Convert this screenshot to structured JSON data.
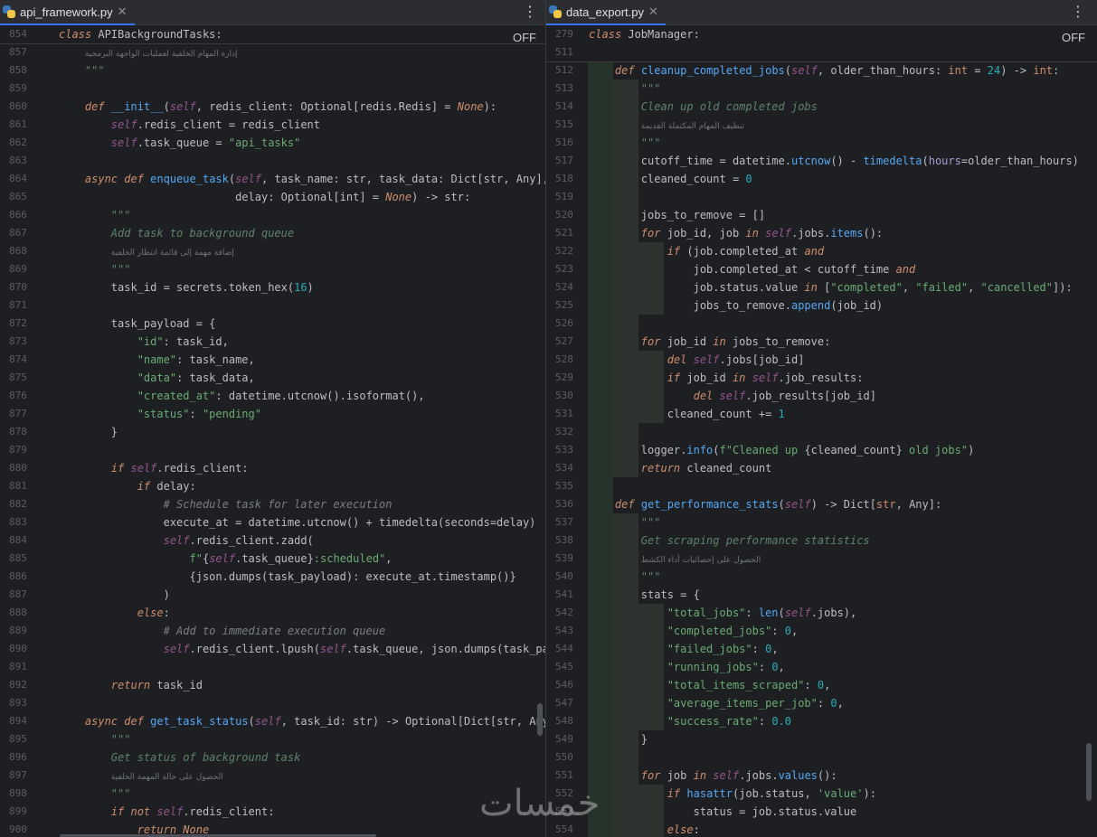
{
  "left": {
    "tab_label": "api_framework.py",
    "sticky_line_number": "854",
    "sticky_kw": "class",
    "sticky_name": " APIBackgroundTasks:",
    "off_label": "OFF",
    "lines": [
      {
        "n": "857",
        "html": "    <span class='ar'>إدارة المهام الخلفية لعمليات الواجهة البرمجية</span>"
      },
      {
        "n": "858",
        "html": "    <span class='doc'>\"\"\"</span>"
      },
      {
        "n": "859",
        "html": ""
      },
      {
        "n": "860",
        "html": "    <span class='kwi'>def</span> <span class='fn'>__init__</span>(<span class='self'>self</span>, redis_client: Optional[redis.Redis] = <span class='kwi'>None</span>):"
      },
      {
        "n": "861",
        "html": "        <span class='self'>self</span>.redis_client = redis_client"
      },
      {
        "n": "862",
        "html": "        <span class='self'>self</span>.task_queue = <span class='str'>\"api_tasks\"</span>"
      },
      {
        "n": "863",
        "html": ""
      },
      {
        "n": "864",
        "html": "    <span class='kwi'>async def</span> <span class='fn'>enqueue_task</span>(<span class='self'>self</span>, task_name: str, task_data: Dict[str, Any],"
      },
      {
        "n": "865",
        "html": "                           delay: Optional[int] = <span class='kwi'>None</span>) -> str:"
      },
      {
        "n": "866",
        "html": "        <span class='doc'>\"\"\"</span>"
      },
      {
        "n": "867",
        "html": "        <span class='doc'>Add task to background queue</span>"
      },
      {
        "n": "868",
        "html": "        <span class='ar'>إضافة مهمة إلى قائمة انتظار الخلفية</span>"
      },
      {
        "n": "869",
        "html": "        <span class='doc'>\"\"\"</span>"
      },
      {
        "n": "870",
        "html": "        task_id = secrets.token_hex(<span class='num'>16</span>)"
      },
      {
        "n": "871",
        "html": ""
      },
      {
        "n": "872",
        "html": "        task_payload = {"
      },
      {
        "n": "873",
        "html": "            <span class='str'>\"id\"</span>: task_id,"
      },
      {
        "n": "874",
        "html": "            <span class='str'>\"name\"</span>: task_name,"
      },
      {
        "n": "875",
        "html": "            <span class='str'>\"data\"</span>: task_data,"
      },
      {
        "n": "876",
        "html": "            <span class='str'>\"created_at\"</span>: datetime.utcnow().isoformat(),"
      },
      {
        "n": "877",
        "html": "            <span class='str'>\"status\"</span>: <span class='str'>\"pending\"</span>"
      },
      {
        "n": "878",
        "html": "        }"
      },
      {
        "n": "879",
        "html": ""
      },
      {
        "n": "880",
        "html": "        <span class='kwi'>if</span> <span class='self'>self</span>.redis_client:"
      },
      {
        "n": "881",
        "html": "            <span class='kwi'>if</span> delay:"
      },
      {
        "n": "882",
        "html": "                <span class='cmt'># Schedule task for later execution</span>"
      },
      {
        "n": "883",
        "html": "                execute_at = datetime.utcnow() + timedelta(seconds=delay)"
      },
      {
        "n": "884",
        "html": "                <span class='self'>self</span>.redis_client.zadd("
      },
      {
        "n": "885",
        "html": "                    <span class='str'>f\"</span>{<span class='self'>self</span>.task_queue}<span class='str'>:scheduled\"</span>,"
      },
      {
        "n": "886",
        "html": "                    {json.dumps(task_payload): execute_at.timestamp()}"
      },
      {
        "n": "887",
        "html": "                )"
      },
      {
        "n": "888",
        "html": "            <span class='kwi'>else</span>:"
      },
      {
        "n": "889",
        "html": "                <span class='cmt'># Add to immediate execution queue</span>"
      },
      {
        "n": "890",
        "html": "                <span class='self'>self</span>.redis_client.lpush(<span class='self'>self</span>.task_queue, json.dumps(task_payl"
      },
      {
        "n": "891",
        "html": ""
      },
      {
        "n": "892",
        "html": "        <span class='kwi'>return</span> task_id"
      },
      {
        "n": "893",
        "html": ""
      },
      {
        "n": "894",
        "html": "    <span class='kwi'>async def</span> <span class='fn'>get_task_status</span>(<span class='self'>self</span>, task_id: str) -> Optional[Dict[str, Any]]"
      },
      {
        "n": "895",
        "html": "        <span class='doc'>\"\"\"</span>"
      },
      {
        "n": "896",
        "html": "        <span class='doc'>Get status of background task</span>"
      },
      {
        "n": "897",
        "html": "        <span class='ar'>الحصول على حالة المهمة الخلفية</span>"
      },
      {
        "n": "898",
        "html": "        <span class='doc'>\"\"\"</span>"
      },
      {
        "n": "899",
        "html": "        <span class='kwi'>if not</span> <span class='self'>self</span>.redis_client:"
      },
      {
        "n": "900",
        "html": "            <span class='kwi'>return None</span>"
      }
    ]
  },
  "right": {
    "tab_label": "data_export.py",
    "sticky_line_number": "279",
    "sticky_kw": "class",
    "sticky_name": " JobManager:",
    "sticky_line_number_2": "511",
    "off_label": "OFF",
    "lines": [
      {
        "n": "512",
        "html": "    <span class='kwi'>def</span> <span class='fn'>cleanup_completed_jobs</span>(<span class='self'>self</span>, older_than_hours: <span class='kw'>int</span> = <span class='num'>24</span>) -> <span class='kw'>int</span>:"
      },
      {
        "n": "513",
        "html": "        <span class='doc'>\"\"\"</span>"
      },
      {
        "n": "514",
        "html": "        <span class='doc'>Clean up old completed jobs</span>"
      },
      {
        "n": "515",
        "html": "        <span class='ar'>تنظيف المهام المكتملة القديمة</span>"
      },
      {
        "n": "516",
        "html": "        <span class='doc'>\"\"\"</span>"
      },
      {
        "n": "517",
        "html": "        cutoff_time = datetime.<span class='call'>utcnow</span>() - <span class='call'>timedelta</span>(<span class='param'>hours</span>=older_than_hours)"
      },
      {
        "n": "518",
        "html": "        cleaned_count = <span class='num'>0</span>"
      },
      {
        "n": "519",
        "html": ""
      },
      {
        "n": "520",
        "html": "        jobs_to_remove = []"
      },
      {
        "n": "521",
        "html": "        <span class='kwi'>for</span> job_id, job <span class='kwi'>in</span> <span class='self'>self</span>.jobs.<span class='call'>items</span>():"
      },
      {
        "n": "522",
        "html": "            <span class='kwi'>if</span> (job.completed_at <span class='kwi'>and</span>"
      },
      {
        "n": "523",
        "html": "                job.completed_at &lt; cutoff_time <span class='kwi'>and</span>"
      },
      {
        "n": "524",
        "html": "                job.status.value <span class='kwi'>in</span> [<span class='str'>\"completed\"</span>, <span class='str'>\"failed\"</span>, <span class='str'>\"cancelled\"</span>]):"
      },
      {
        "n": "525",
        "html": "                jobs_to_remove.<span class='call'>append</span>(job_id)"
      },
      {
        "n": "526",
        "html": ""
      },
      {
        "n": "527",
        "html": "        <span class='kwi'>for</span> job_id <span class='kwi'>in</span> jobs_to_remove:"
      },
      {
        "n": "528",
        "html": "            <span class='kwi'>del</span> <span class='self'>self</span>.jobs[job_id]"
      },
      {
        "n": "529",
        "html": "            <span class='kwi'>if</span> job_id <span class='kwi'>in</span> <span class='self'>self</span>.job_results:"
      },
      {
        "n": "530",
        "html": "                <span class='kwi'>del</span> <span class='self'>self</span>.job_results[job_id]"
      },
      {
        "n": "531",
        "html": "            cleaned_count += <span class='num'>1</span>"
      },
      {
        "n": "532",
        "html": ""
      },
      {
        "n": "533",
        "html": "        logger.<span class='call'>info</span>(<span class='str'>f\"Cleaned up </span>{cleaned_count}<span class='str'> old jobs\"</span>)"
      },
      {
        "n": "534",
        "html": "        <span class='kwi'>return</span> cleaned_count"
      },
      {
        "n": "535",
        "html": ""
      },
      {
        "n": "536",
        "html": "    <span class='kwi'>def</span> <span class='fn'>get_performance_stats</span>(<span class='self'>self</span>) -> Dict[<span class='kw'>str</span>, Any]:"
      },
      {
        "n": "537",
        "html": "        <span class='doc'>\"\"\"</span>"
      },
      {
        "n": "538",
        "html": "        <span class='doc'>Get scraping performance statistics</span>"
      },
      {
        "n": "539",
        "html": "        <span class='ar'>الحصول على إحصائيات أداء الكشط</span>"
      },
      {
        "n": "540",
        "html": "        <span class='doc'>\"\"\"</span>"
      },
      {
        "n": "541",
        "html": "        stats = {"
      },
      {
        "n": "542",
        "html": "            <span class='str'>\"total_jobs\"</span>: <span class='call'>len</span>(<span class='self'>self</span>.jobs),"
      },
      {
        "n": "543",
        "html": "            <span class='str'>\"completed_jobs\"</span>: <span class='num'>0</span>,"
      },
      {
        "n": "544",
        "html": "            <span class='str'>\"failed_jobs\"</span>: <span class='num'>0</span>,"
      },
      {
        "n": "545",
        "html": "            <span class='str'>\"running_jobs\"</span>: <span class='num'>0</span>,"
      },
      {
        "n": "546",
        "html": "            <span class='str'>\"total_items_scraped\"</span>: <span class='num'>0</span>,"
      },
      {
        "n": "547",
        "html": "            <span class='str'>\"average_items_per_job\"</span>: <span class='num'>0</span>,"
      },
      {
        "n": "548",
        "html": "            <span class='str'>\"success_rate\"</span>: <span class='num'>0.0</span>"
      },
      {
        "n": "549",
        "html": "        }"
      },
      {
        "n": "550",
        "html": ""
      },
      {
        "n": "551",
        "html": "        <span class='kwi'>for</span> job <span class='kwi'>in</span> <span class='self'>self</span>.jobs.<span class='call'>values</span>():"
      },
      {
        "n": "552",
        "html": "            <span class='kwi'>if</span> <span class='call'>hasattr</span>(job.status, <span class='str'>'value'</span>):"
      },
      {
        "n": "553",
        "html": "                status = job.status.value"
      },
      {
        "n": "554",
        "html": "            <span class='kwi'>else</span>:"
      }
    ]
  },
  "watermark": "خمسات"
}
